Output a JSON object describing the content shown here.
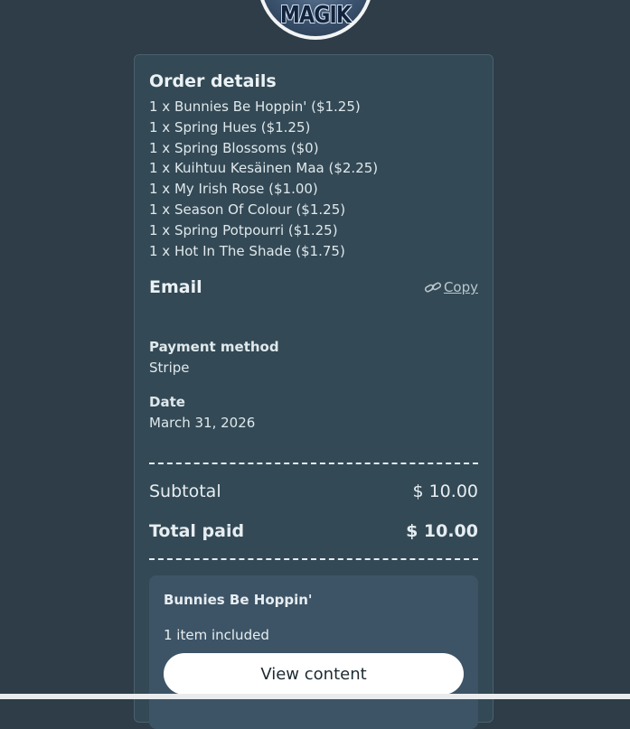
{
  "avatar": {
    "text": "MAGIK"
  },
  "order": {
    "title": "Order details",
    "items": [
      "1 x Bunnies Be Hoppin' ($1.25)",
      "1 x Spring Hues ($1.25)",
      "1 x Spring Blossoms ($0)",
      "1 x Kuihtuu Kesäinen Maa ($2.25)",
      "1 x My Irish Rose ($1.00)",
      "1 x Season Of Colour ($1.25)",
      "1 x Spring Potpourri ($1.25)",
      "1 x Hot In The Shade ($1.75)"
    ]
  },
  "email": {
    "label": "Email",
    "copy_label": "Copy",
    "copy_icon": "link-icon"
  },
  "payment": {
    "label": "Payment method",
    "value": "Stripe"
  },
  "date": {
    "label": "Date",
    "value": "March 31, 2026"
  },
  "summary": {
    "subtotal_label": "Subtotal",
    "subtotal_value": "$ 10.00",
    "total_label": "Total paid",
    "total_value": "$ 10.00"
  },
  "product": {
    "name": "Bunnies Be Hoppin'",
    "count": "1 item included",
    "button_label": "View content"
  },
  "colors": {
    "background": "#2e3d47",
    "card": "#334955",
    "product_box": "#3d5466",
    "button": "#ffffff"
  }
}
